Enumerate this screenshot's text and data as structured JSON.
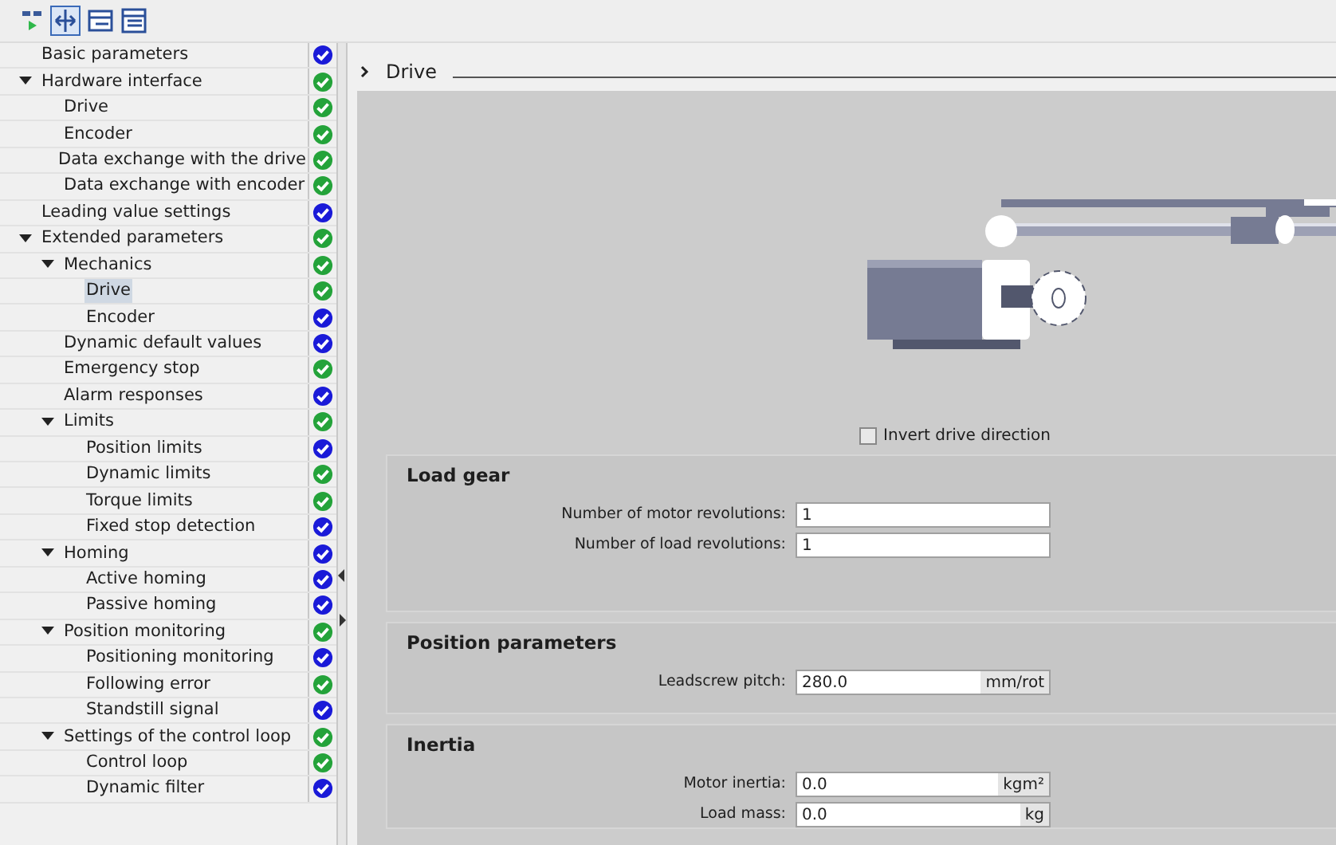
{
  "tree": [
    {
      "label": "Basic parameters",
      "color": "#1a1ad8",
      "selected": false
    },
    {
      "label": "Hardware interface",
      "color": "#24a33a",
      "selected": false,
      "expanded": true,
      "children": [
        {
          "label": "Drive",
          "color": "#24a33a",
          "selected": false
        },
        {
          "label": "Encoder",
          "color": "#24a33a",
          "selected": false
        },
        {
          "label": "Data exchange with the drive",
          "color": "#24a33a",
          "selected": false
        },
        {
          "label": "Data exchange with encoder",
          "color": "#24a33a",
          "selected": false
        }
      ]
    },
    {
      "label": "Leading value settings",
      "color": "#1a1ad8",
      "selected": false
    },
    {
      "label": "Extended parameters",
      "color": "#24a33a",
      "selected": false,
      "expanded": true,
      "children": [
        {
          "label": "Mechanics",
          "color": "#24a33a",
          "selected": false,
          "expanded": true,
          "children": [
            {
              "label": "Drive",
              "color": "#24a33a",
              "selected": true
            },
            {
              "label": "Encoder",
              "color": "#1a1ad8",
              "selected": false
            }
          ]
        },
        {
          "label": "Dynamic default values",
          "color": "#1a1ad8",
          "selected": false
        },
        {
          "label": "Emergency stop",
          "color": "#24a33a",
          "selected": false
        },
        {
          "label": "Alarm responses",
          "color": "#1a1ad8",
          "selected": false
        },
        {
          "label": "Limits",
          "color": "#24a33a",
          "selected": false,
          "expanded": true,
          "children": [
            {
              "label": "Position limits",
              "color": "#1a1ad8",
              "selected": false
            },
            {
              "label": "Dynamic limits",
              "color": "#24a33a",
              "selected": false
            },
            {
              "label": "Torque limits",
              "color": "#24a33a",
              "selected": false
            },
            {
              "label": "Fixed stop detection",
              "color": "#1a1ad8",
              "selected": false
            }
          ]
        },
        {
          "label": "Homing",
          "color": "#1a1ad8",
          "selected": false,
          "expanded": true,
          "children": [
            {
              "label": "Active homing",
              "color": "#1a1ad8",
              "selected": false
            },
            {
              "label": "Passive homing",
              "color": "#1a1ad8",
              "selected": false
            }
          ]
        },
        {
          "label": "Position monitoring",
          "color": "#24a33a",
          "selected": false,
          "expanded": true,
          "children": [
            {
              "label": "Positioning monitoring",
              "color": "#1a1ad8",
              "selected": false
            },
            {
              "label": "Following error",
              "color": "#24a33a",
              "selected": false
            },
            {
              "label": "Standstill signal",
              "color": "#1a1ad8",
              "selected": false
            }
          ]
        },
        {
          "label": "Settings of the control loop",
          "color": "#24a33a",
          "selected": false,
          "expanded": true,
          "children": [
            {
              "label": "Control loop",
              "color": "#24a33a",
              "selected": false
            },
            {
              "label": "Dynamic filter",
              "color": "#1a1ad8",
              "selected": false
            }
          ]
        }
      ]
    }
  ],
  "header": {
    "title": "Drive"
  },
  "invert_drive_direction": {
    "label": "Invert drive direction",
    "checked": false
  },
  "sections": [
    {
      "title": "Load gear",
      "fields": [
        {
          "label": "Number of motor revolutions:",
          "value": "1"
        },
        {
          "label": "Number of load revolutions:",
          "value": "1"
        }
      ]
    },
    {
      "title": "Position parameters",
      "fields": [
        {
          "label": "Leadscrew pitch:",
          "value": "280.0",
          "unit": "mm/rot"
        }
      ]
    },
    {
      "title": "Inertia",
      "fields": [
        {
          "label": "Motor inertia:",
          "value": "0.0",
          "unit": "kgm²"
        },
        {
          "label": "Load mass:",
          "value": "0.0",
          "unit": "kg"
        }
      ]
    }
  ]
}
